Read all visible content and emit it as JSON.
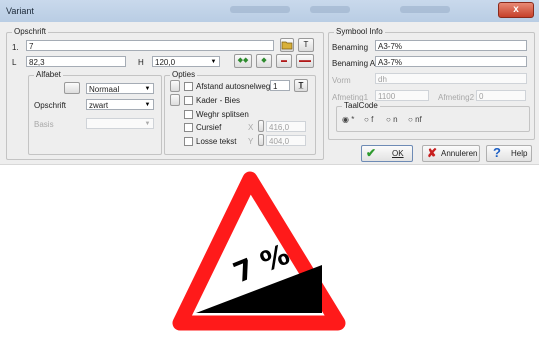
{
  "window": {
    "title": "Variant",
    "close_glyph": "x"
  },
  "opschrift": {
    "group_label": "Opschrift",
    "line1_label": "1.",
    "line1_value": "7",
    "L_label": "L",
    "L_value": "82,3",
    "H_label": "H",
    "H_value": "120,0",
    "T_btn": "T",
    "align_btns": [
      "◆◆",
      "◆",
      "▬",
      "▬▬"
    ]
  },
  "alfabet": {
    "group_label": "Alfabet",
    "font_value": "Normaal",
    "opschrift_label": "Opschrift",
    "opschrift_value": "zwart",
    "basis_label": "Basis",
    "basis_value": ""
  },
  "opties": {
    "group_label": "Opties",
    "afstand_label": "Afstand autosnelweg",
    "afstand_value": "1",
    "kader_label": "Kader - Bies",
    "weghr_label": "Weghr splitsen",
    "cursief_label": "Cursief",
    "losse_label": "Losse tekst",
    "x_label": "X",
    "x_value": "416,0",
    "y_label": "Y",
    "y_value": "404,0"
  },
  "symbool": {
    "group_label": "Symbool Info",
    "benaming_label": "Benaming",
    "benaming_value": "A3-7%",
    "benaming_alt_label": "Benaming Alt",
    "benaming_alt_value": "A3-7%",
    "vorm_label": "Vorm",
    "vorm_value": "dh",
    "afm1_label": "Afmeting1",
    "afm1_value": "1100",
    "afm2_label": "Afmeting2",
    "afm2_value": "0",
    "taalcode_label": "TaalCode",
    "taal_options": [
      "*",
      "f",
      "n",
      "nf"
    ],
    "taal_selected": "*"
  },
  "buttons": {
    "ok": "OK",
    "annuleren": "Annuleren",
    "help": "Help"
  },
  "sign": {
    "text": "7 %",
    "border_color": "#ff1a1a",
    "fill_color": "#000000"
  },
  "colors": {
    "ok_check": "#2e9a2e",
    "cancel_x": "#c82020",
    "help_q": "#1d5fc4"
  }
}
